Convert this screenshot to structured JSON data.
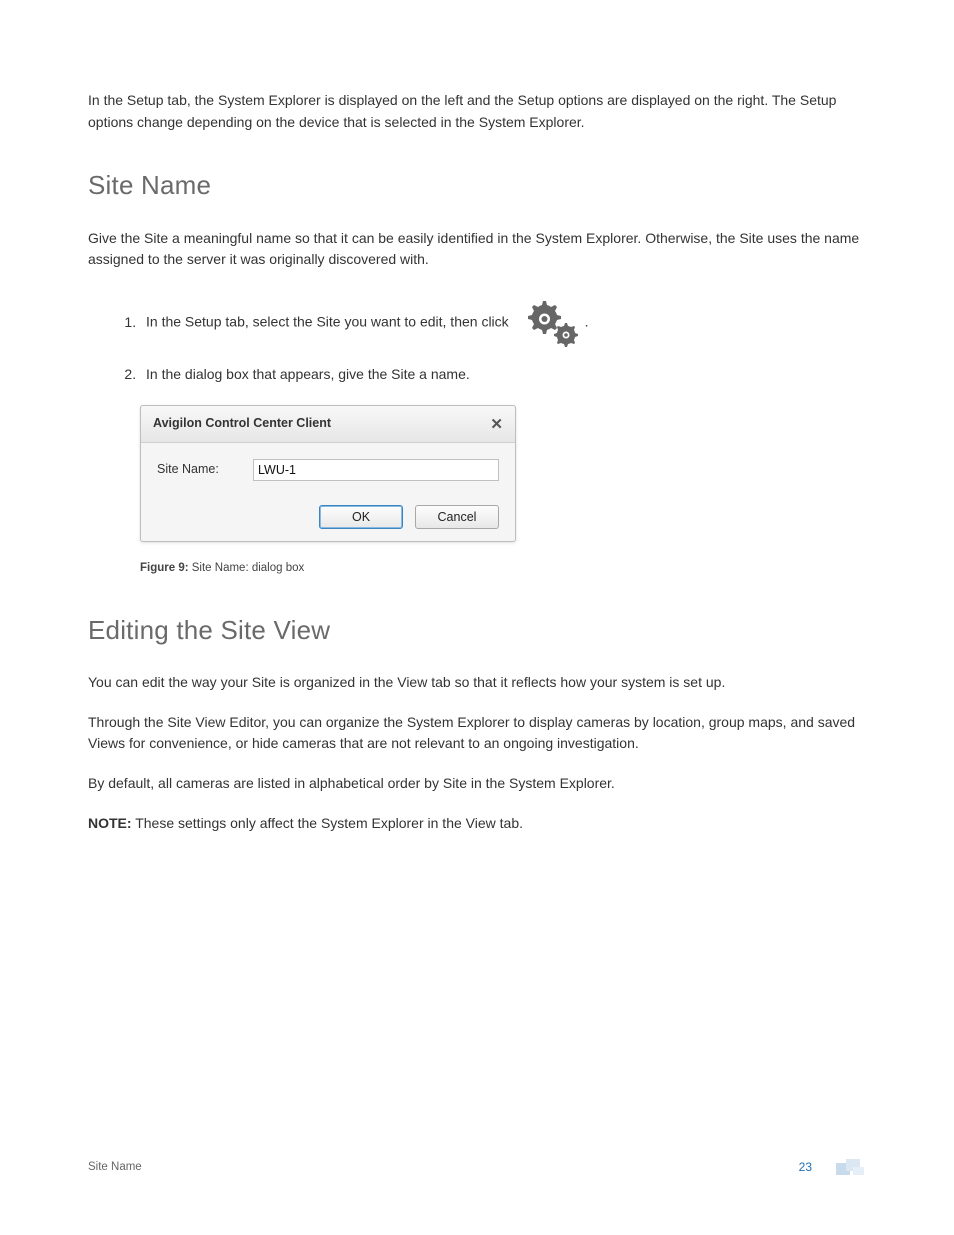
{
  "intro": "In the Setup tab, the System Explorer is displayed on the left and the Setup options are displayed on the right. The Setup options change depending on the device that is selected in the System Explorer.",
  "section1": {
    "heading": "Site Name",
    "para": "Give the Site a meaningful name so that it can be easily identified in the System Explorer. Otherwise, the Site uses the name assigned to the server it was originally discovered with.",
    "steps": {
      "s1_pre": "In the Setup tab, select the Site you want to edit, then click",
      "s1_post": ".",
      "s2": "In the dialog box that appears, give the Site a name."
    }
  },
  "dialog": {
    "title": "Avigilon Control Center Client",
    "field_label": "Site Name:",
    "field_value": "LWU-1",
    "ok": "OK",
    "cancel": "Cancel"
  },
  "figure": {
    "label": "Figure 9:",
    "text": " Site Name: dialog box"
  },
  "section2": {
    "heading": "Editing the Site View",
    "p1": "You can edit the way your Site is organized in the View tab so that it reflects how your system is set up.",
    "p2": "Through the Site View Editor, you can organize the System Explorer to display cameras by location, group maps, and saved Views for convenience, or hide cameras that are not relevant to an ongoing investigation.",
    "p3": "By default, all cameras are listed in alphabetical order by Site in the System Explorer.",
    "note_label": "NOTE:",
    "note_text": " These settings only affect the System Explorer in the View tab."
  },
  "footer": {
    "left": "Site Name",
    "page": "23"
  }
}
